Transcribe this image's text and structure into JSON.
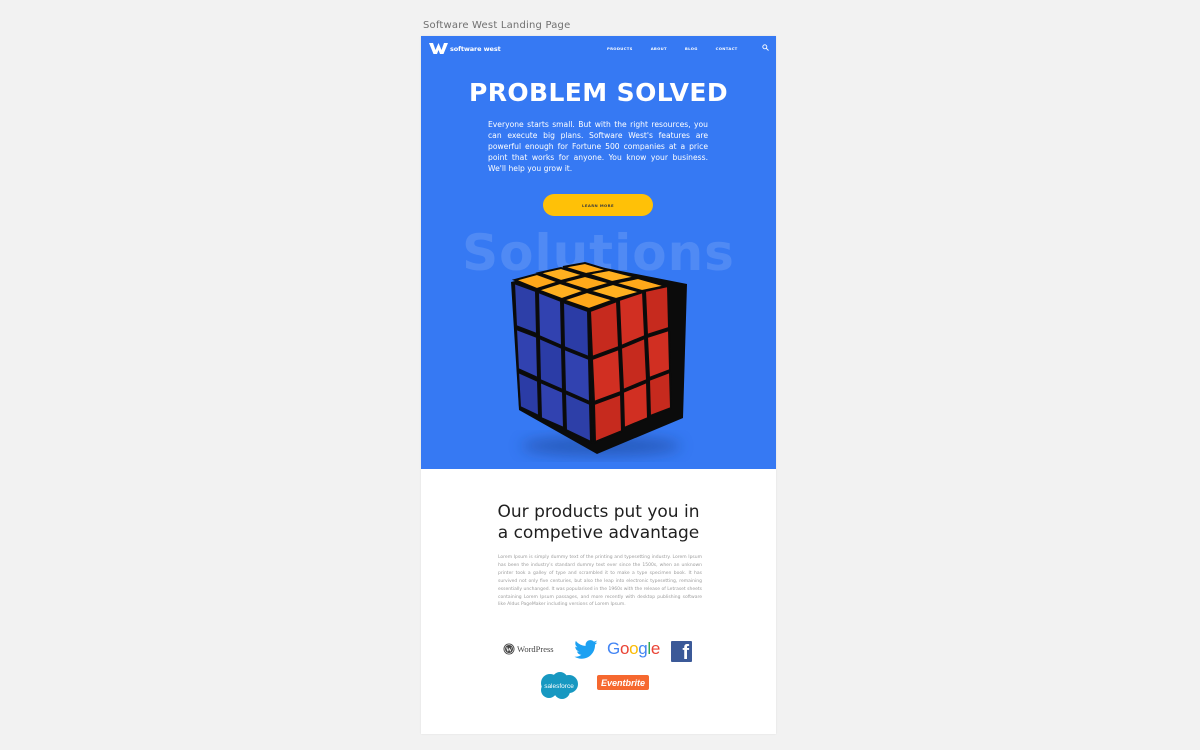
{
  "frame": {
    "label": "Software West Landing Page"
  },
  "nav": {
    "brand": "software west",
    "links": [
      "PRODUCTS",
      "ABOUT",
      "BLOG",
      "CONTACT"
    ],
    "search_icon": "search-icon"
  },
  "hero": {
    "title": "PROBLEM SOLVED",
    "text": "Everyone starts small. But with the right resources, you can execute big plans. Software West's features are powerful enough for Fortune 500 companies at a price point that works for anyone. You know your business. We'll help you grow it.",
    "cta_label": "LEARN MORE",
    "watermark": "Solutions",
    "image": "rubiks-cube-image",
    "color": "#3679f3",
    "cta_color": "#ffc107"
  },
  "products": {
    "title_line1": "Our products put you in",
    "title_line2": "a competive advantage",
    "body": "Lorem Ipsum is simply dummy text of the printing and typesetting industry. Lorem Ipsum has been the industry's standard dummy text ever since the 1500s, when an unknown printer took a galley of type and scrambled it to make a type specimen book. It has survived not only five centuries, but also the leap into electronic typesetting, remaining essentially unchanged. It was popularised in the 1960s with the release of Letraset sheets containing Lorem Ipsum passages, and more recently with desktop publishing software like Aldus PageMaker including versions of Lorem Ipsum."
  },
  "partner_logos": {
    "wordpress": "WordPress",
    "twitter": "twitter-bird-logo",
    "google": "Google",
    "facebook": "f",
    "salesforce": "salesforce",
    "eventbrite": "Eventbrite"
  }
}
